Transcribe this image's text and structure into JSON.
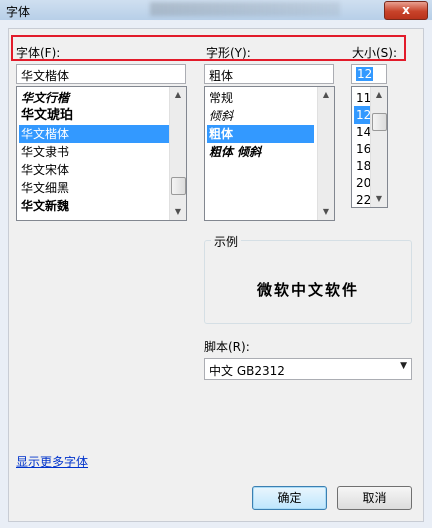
{
  "window": {
    "title": "字体",
    "close_label": "x"
  },
  "font": {
    "label": "字体(F):",
    "value": "华文楷体",
    "items": [
      "华文行楷",
      "华文琥珀",
      "华文楷体",
      "华文隶书",
      "华文宋体",
      "华文细黑",
      "华文新魏"
    ],
    "selected_index": 2
  },
  "style": {
    "label": "字形(Y):",
    "value": "粗体",
    "items": [
      "常规",
      "倾斜",
      "粗体",
      "粗体 倾斜"
    ],
    "selected_index": 2
  },
  "size": {
    "label": "大小(S):",
    "value": "12",
    "items": [
      "11",
      "12",
      "14",
      "16",
      "18",
      "20",
      "22"
    ],
    "selected_index": 1
  },
  "sample": {
    "legend": "示例",
    "text": "微软中文软件"
  },
  "script": {
    "label": "脚本(R):",
    "value": "中文 GB2312"
  },
  "more_fonts_link": "显示更多字体",
  "buttons": {
    "ok": "确定",
    "cancel": "取消"
  },
  "colors": {
    "selection": "#3399ff",
    "highlight_box": "#e21b2a"
  }
}
